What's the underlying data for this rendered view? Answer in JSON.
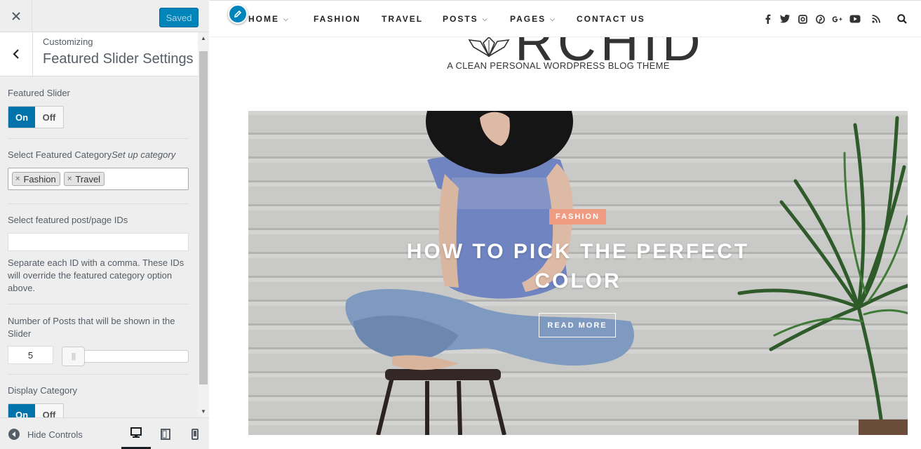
{
  "customizer": {
    "save_label": "Saved",
    "breadcrumb": "Customizing",
    "section_title": "Featured Slider Settings",
    "featured_slider": {
      "label": "Featured Slider",
      "on": "On",
      "off": "Off",
      "value": "On"
    },
    "featured_category": {
      "label": "Select Featured Category",
      "link": "Set up category",
      "selected": [
        "Fashion",
        "Travel"
      ]
    },
    "post_ids": {
      "label": "Select featured post/page IDs",
      "value": "",
      "help": "Separate each ID with a comma. These IDs will override the featured category option above."
    },
    "posts_count": {
      "label": "Number of Posts that will be shown in the Slider",
      "value": "5"
    },
    "display_category": {
      "label": "Display Category",
      "on": "On",
      "off": "Off",
      "value": "On"
    },
    "footer": {
      "hide_controls": "Hide Controls"
    }
  },
  "site": {
    "nav": [
      {
        "label": "HOME",
        "dropdown": true
      },
      {
        "label": "FASHION",
        "dropdown": false
      },
      {
        "label": "TRAVEL",
        "dropdown": false
      },
      {
        "label": "POSTS",
        "dropdown": true
      },
      {
        "label": "PAGES",
        "dropdown": true
      },
      {
        "label": "CONTACT US",
        "dropdown": false
      }
    ],
    "social_icons": [
      "facebook-icon",
      "twitter-icon",
      "instagram-icon",
      "pinterest-icon",
      "google-plus-icon",
      "youtube-icon",
      "rss-icon",
      "search-icon"
    ],
    "logo_text": "RCHID",
    "tagline": "A CLEAN PERSONAL WORDPRESS BLOG THEME",
    "slide": {
      "category": "FASHION",
      "title": "HOW TO PICK THE PERFECT COLOR",
      "button": "READ MORE"
    }
  },
  "colors": {
    "accent": "#0085ba",
    "toggle_on": "#0073aa",
    "category_badge": "#ef9c82"
  }
}
